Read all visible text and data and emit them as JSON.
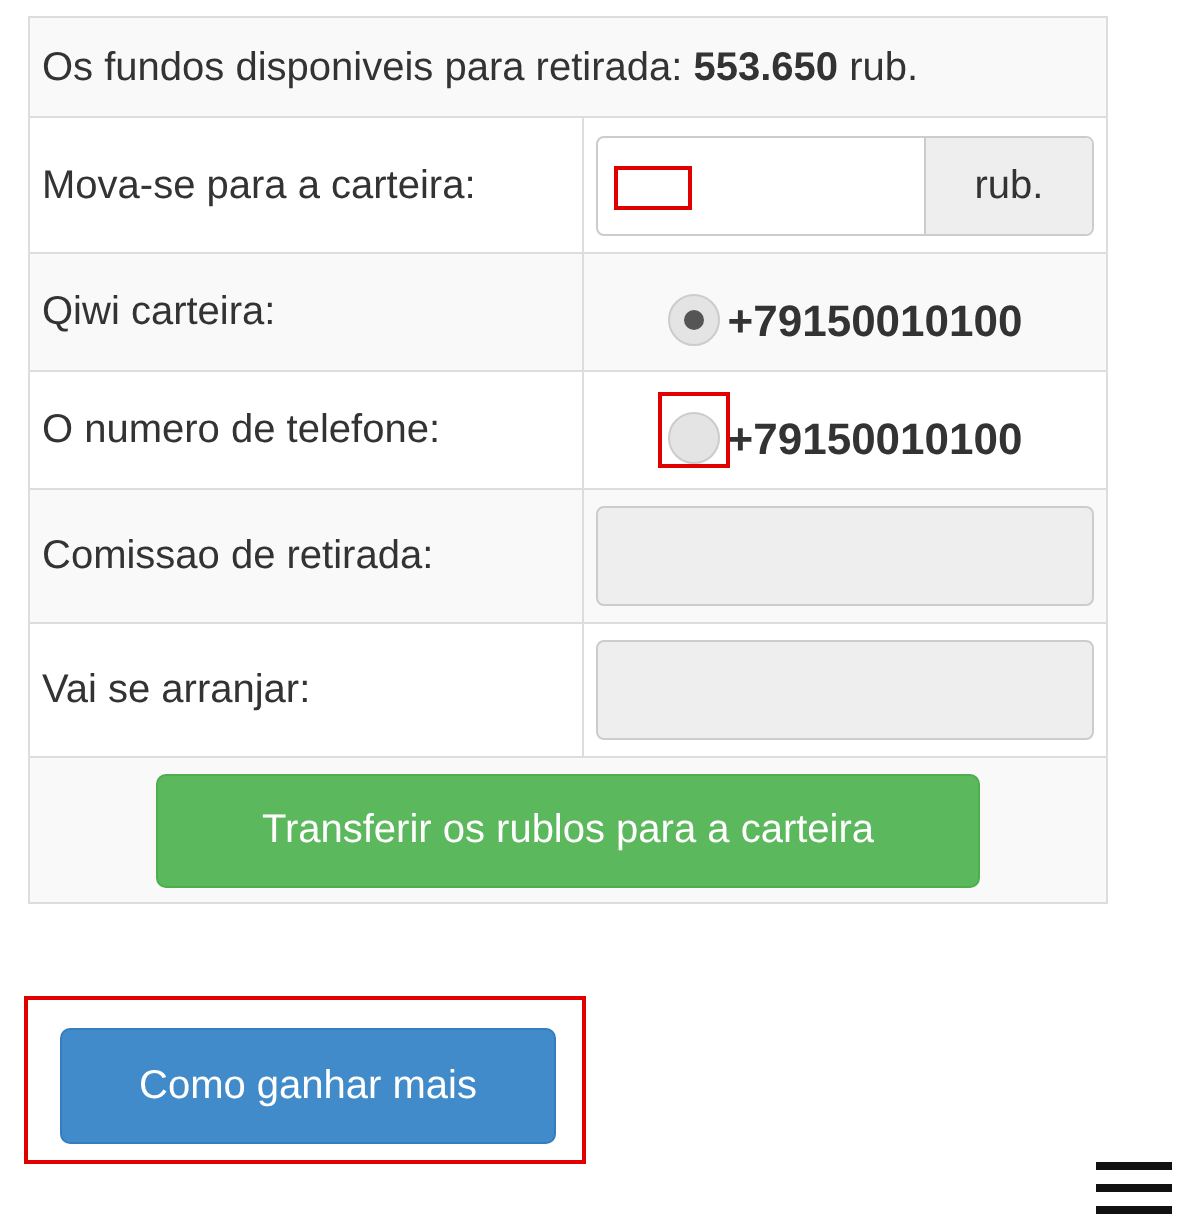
{
  "balance": {
    "text": "Os fundos disponiveis para retirada: **553.650** rub."
  },
  "rows": [
    {
      "kind": "amount_input",
      "label": "Mova-se para a carteira:",
      "addon": "rub.",
      "highlighted": true
    },
    {
      "kind": "radio",
      "label": "Qiwi carteira:",
      "value": "+79150010100",
      "selected": true
    },
    {
      "kind": "radio",
      "label": "O numero de telefone:",
      "value": "+79150010100",
      "selected": false,
      "highlighted": true
    },
    {
      "kind": "readonly",
      "label": "Comissao de retirada:"
    },
    {
      "kind": "readonly",
      "label": "Vai se arranjar:"
    }
  ],
  "submit_button": {
    "label": "Transferir os rublos para a carteira"
  },
  "more_button": {
    "label": "Como ganhar mais",
    "highlighted": true
  }
}
